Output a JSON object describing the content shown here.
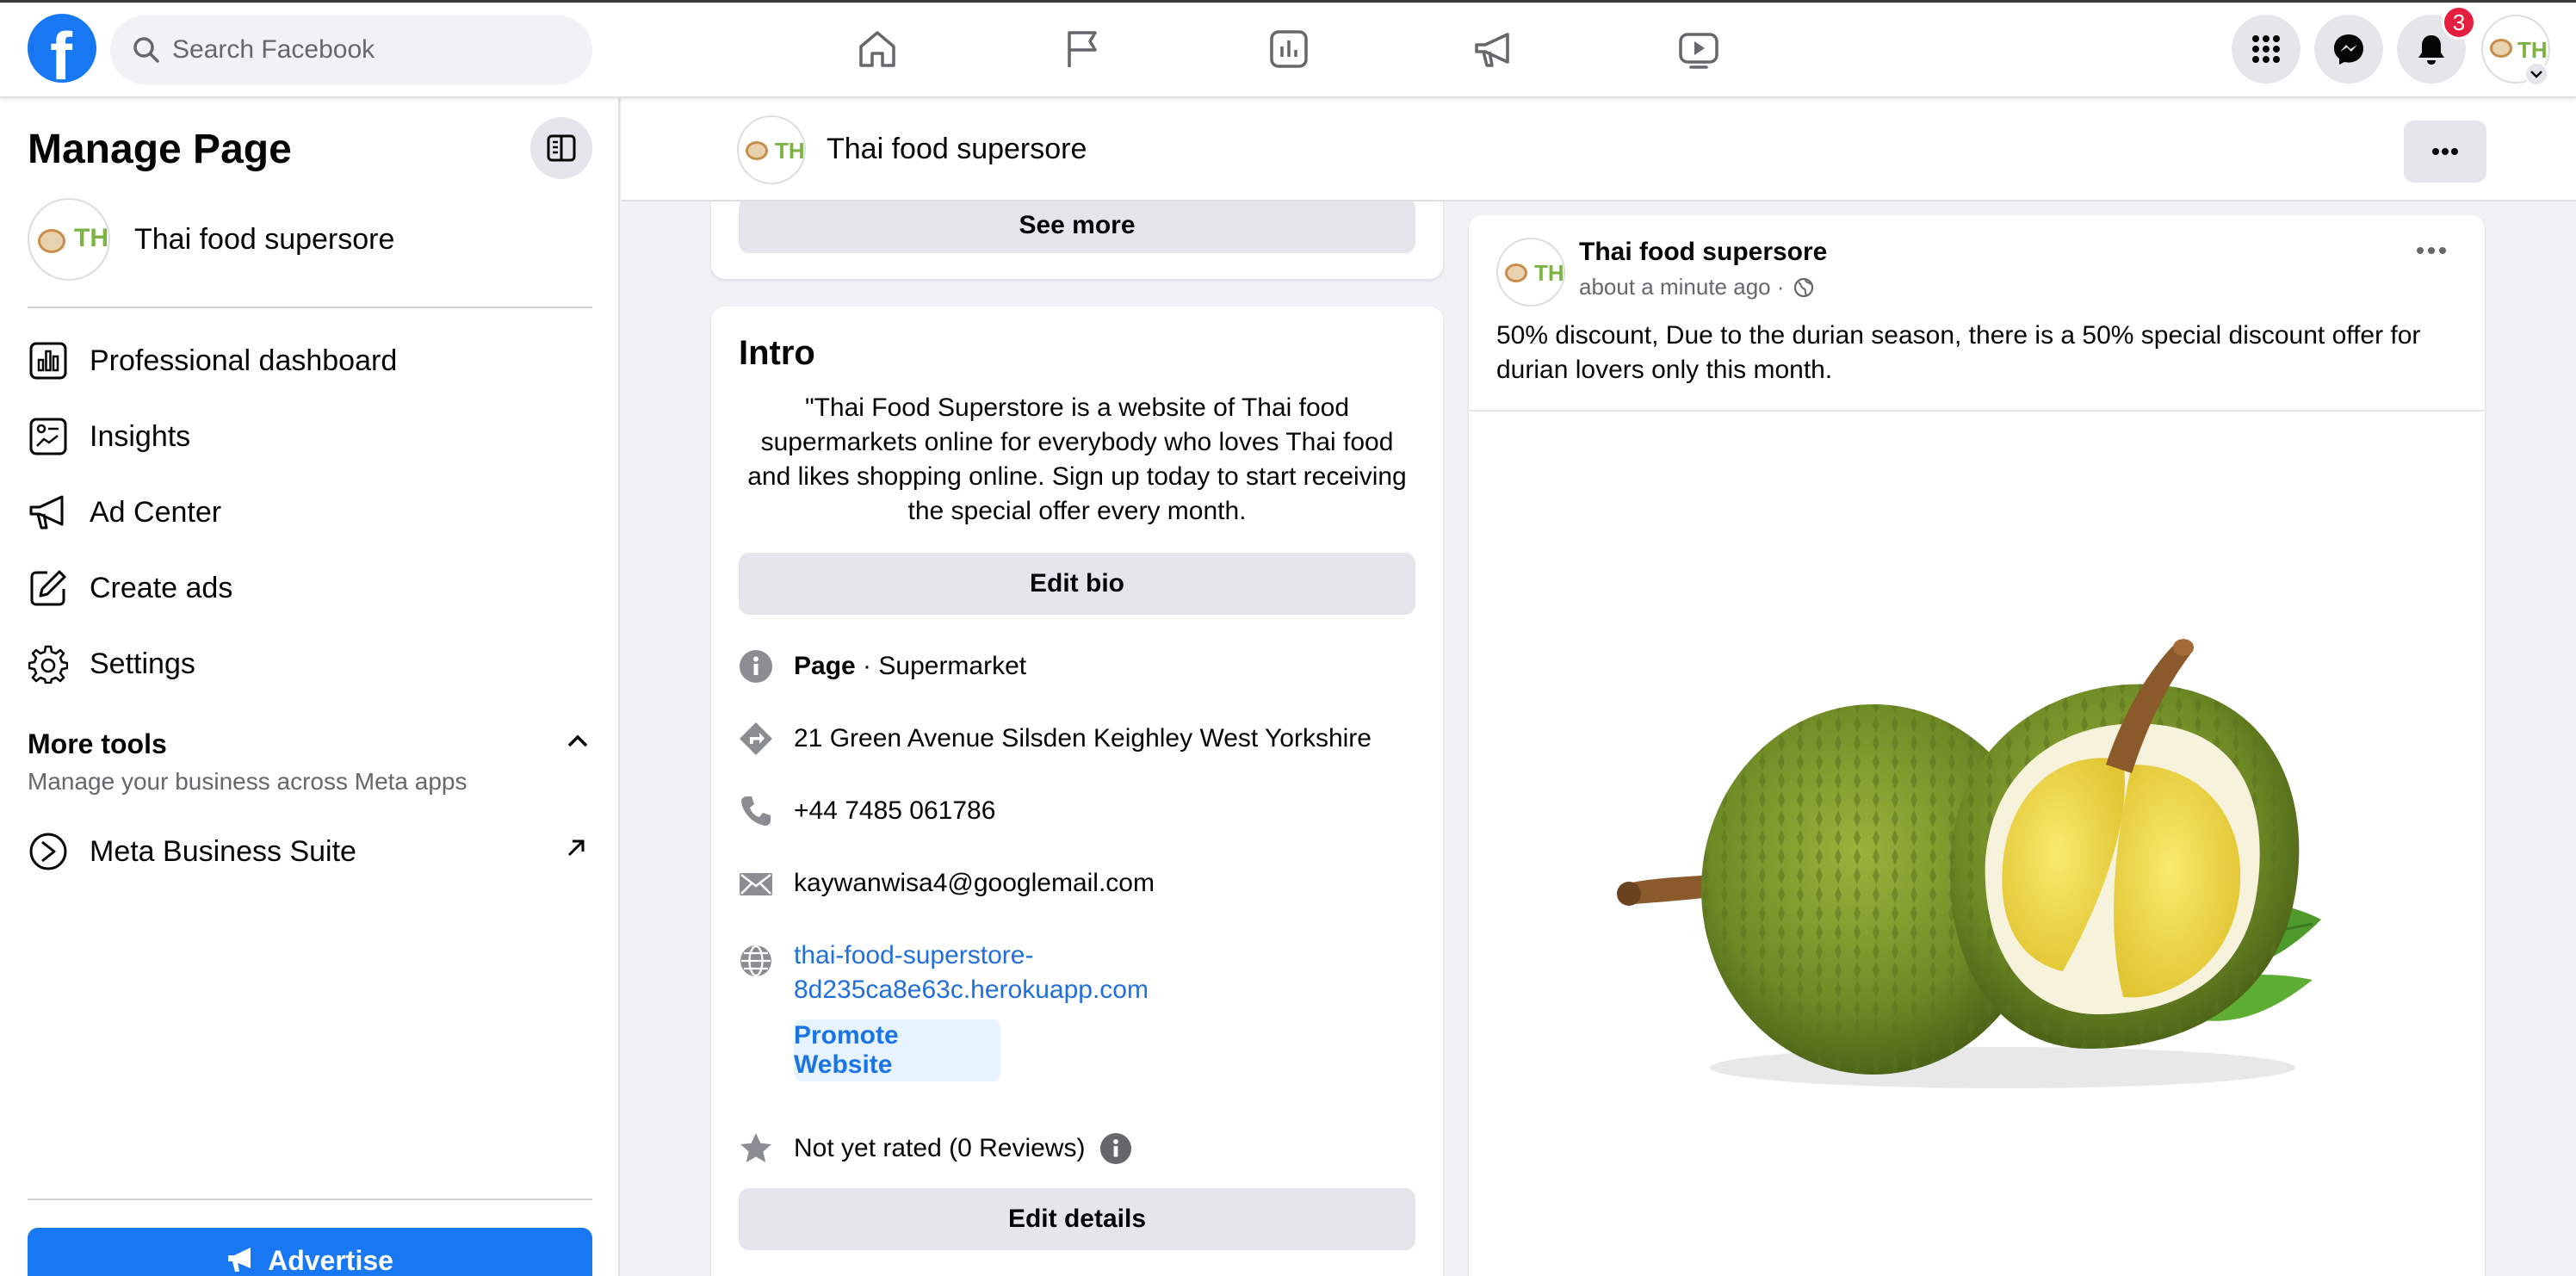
{
  "colors": {
    "brand": "#1877f2",
    "link": "#216fdb",
    "badge": "#e41e3f",
    "background": "#f0f2f5"
  },
  "search": {
    "placeholder": "Search Facebook"
  },
  "topnav": {
    "icons": [
      "home-icon",
      "flag-icon",
      "insights-icon",
      "megaphone-icon",
      "video-icon"
    ],
    "right_icons": [
      "menu-grid-icon",
      "messenger-icon",
      "bell-icon"
    ],
    "notification_count": "3"
  },
  "sidebar": {
    "title": "Manage Page",
    "page_name": "Thai food supersore",
    "avatar_text": "TH",
    "items": [
      {
        "label": "Professional dashboard",
        "icon": "dashboard-icon"
      },
      {
        "label": "Insights",
        "icon": "insights-icon"
      },
      {
        "label": "Ad Center",
        "icon": "megaphone-icon"
      },
      {
        "label": "Create ads",
        "icon": "edit-icon"
      },
      {
        "label": "Settings",
        "icon": "gear-icon"
      }
    ],
    "more_tools": {
      "title": "More tools",
      "subtitle": "Manage your business across Meta apps",
      "item": "Meta Business Suite"
    },
    "advertise_label": "Advertise"
  },
  "page_header": {
    "name": "Thai food supersore"
  },
  "intro": {
    "see_more": "See more",
    "title": "Intro",
    "bio": "\"Thai Food Superstore is a website of Thai food supermarkets online for everybody who loves Thai food and likes shopping online. Sign up today to start receiving the special offer every month.",
    "edit_bio": "Edit bio",
    "category_prefix": "Page",
    "category": " · Supermarket",
    "address": "21 Green Avenue Silsden Keighley West Yorkshire",
    "phone": "+44 7485 061786",
    "email": "kaywanwisa4@googlemail.com",
    "website_line1": "thai-food-superstore-",
    "website_line2": "8d235ca8e63c.herokuapp.com",
    "promote": "Promote Website",
    "rating": "Not yet rated (0 Reviews)",
    "edit_details": "Edit details"
  },
  "post": {
    "author": "Thai food supersore",
    "time": "about a minute ago ·",
    "text": "50% discount, Due to the durian season, there is a 50% special discount offer for durian lovers only this month."
  }
}
